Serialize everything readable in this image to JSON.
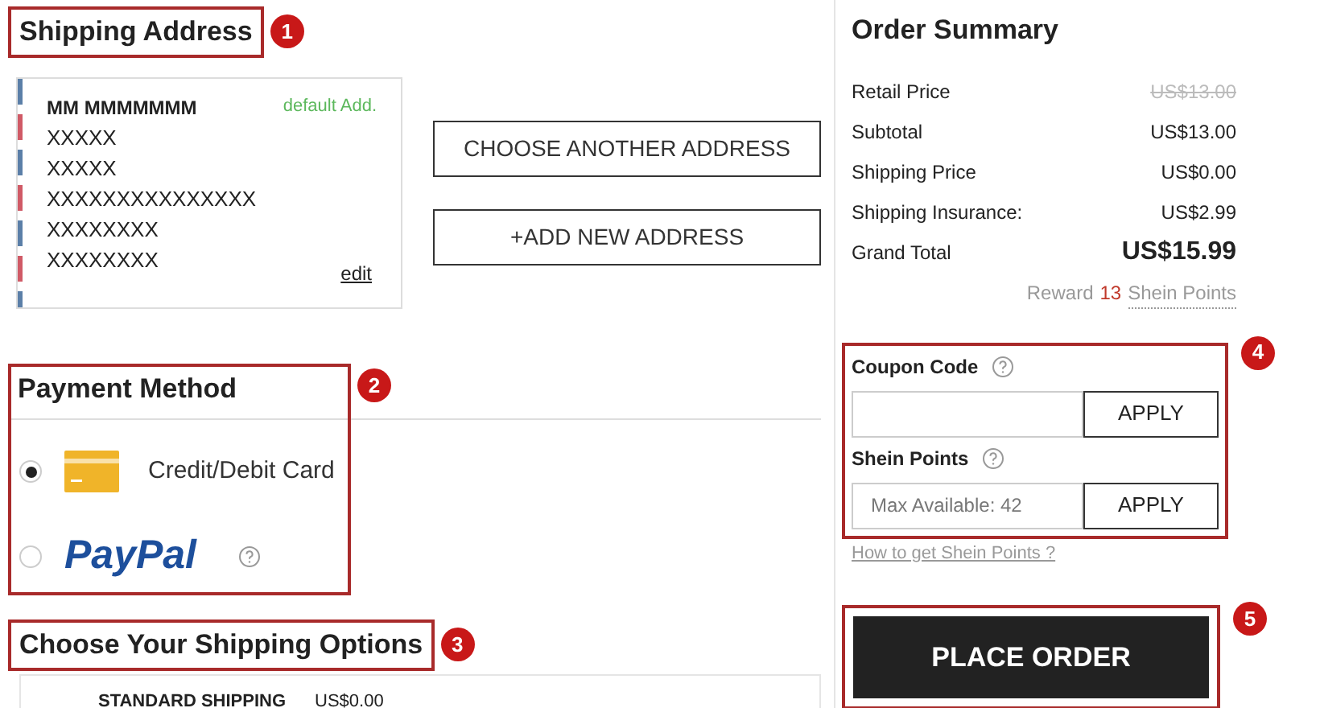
{
  "shipping_address": {
    "title": "Shipping Address",
    "callout": "1",
    "card": {
      "name": "MM MMMMMMM",
      "badge": "default Add.",
      "lines": [
        "XXXXX",
        "XXXXX",
        "XXXXXXXXXXXXXXX",
        "XXXXXXXX",
        "XXXXXXXX"
      ],
      "edit": "edit"
    },
    "buttons": [
      "CHOOSE ANOTHER ADDRESS",
      "+ADD NEW ADDRESS"
    ]
  },
  "payment_method": {
    "title": "Payment Method",
    "callout": "2",
    "options": [
      {
        "kind": "card",
        "label": "Credit/Debit Card",
        "selected": true
      },
      {
        "kind": "paypal",
        "label": "PayPal",
        "selected": false
      }
    ]
  },
  "shipping_options": {
    "title": "Choose Your Shipping Options",
    "callout": "3",
    "rows": [
      {
        "name": "STANDARD SHIPPING",
        "price": "US$0.00"
      }
    ]
  },
  "order_summary": {
    "title": "Order Summary",
    "rows": [
      {
        "kind": "struck",
        "label": "Retail Price",
        "value": "US$13.00"
      },
      {
        "kind": "plain",
        "label": "Subtotal",
        "value": "US$13.00"
      },
      {
        "kind": "plain",
        "label": "Shipping Price",
        "value": "US$0.00"
      },
      {
        "kind": "plain",
        "label": "Shipping Insurance:",
        "value": "US$2.99"
      },
      {
        "kind": "total",
        "label": "Grand Total",
        "value": "US$15.99"
      }
    ],
    "reward": {
      "prefix": "Reward",
      "points": "13",
      "link": "Shein Points"
    }
  },
  "discounts": {
    "callout": "4",
    "fields": [
      {
        "label": "Coupon Code",
        "button": "APPLY"
      },
      {
        "label": "Shein Points",
        "placeholder": "Max Available: 42",
        "button": "APPLY"
      }
    ],
    "link": "How to get Shein Points ?"
  },
  "place_order": {
    "callout": "5",
    "button": "PLACE ORDER"
  }
}
